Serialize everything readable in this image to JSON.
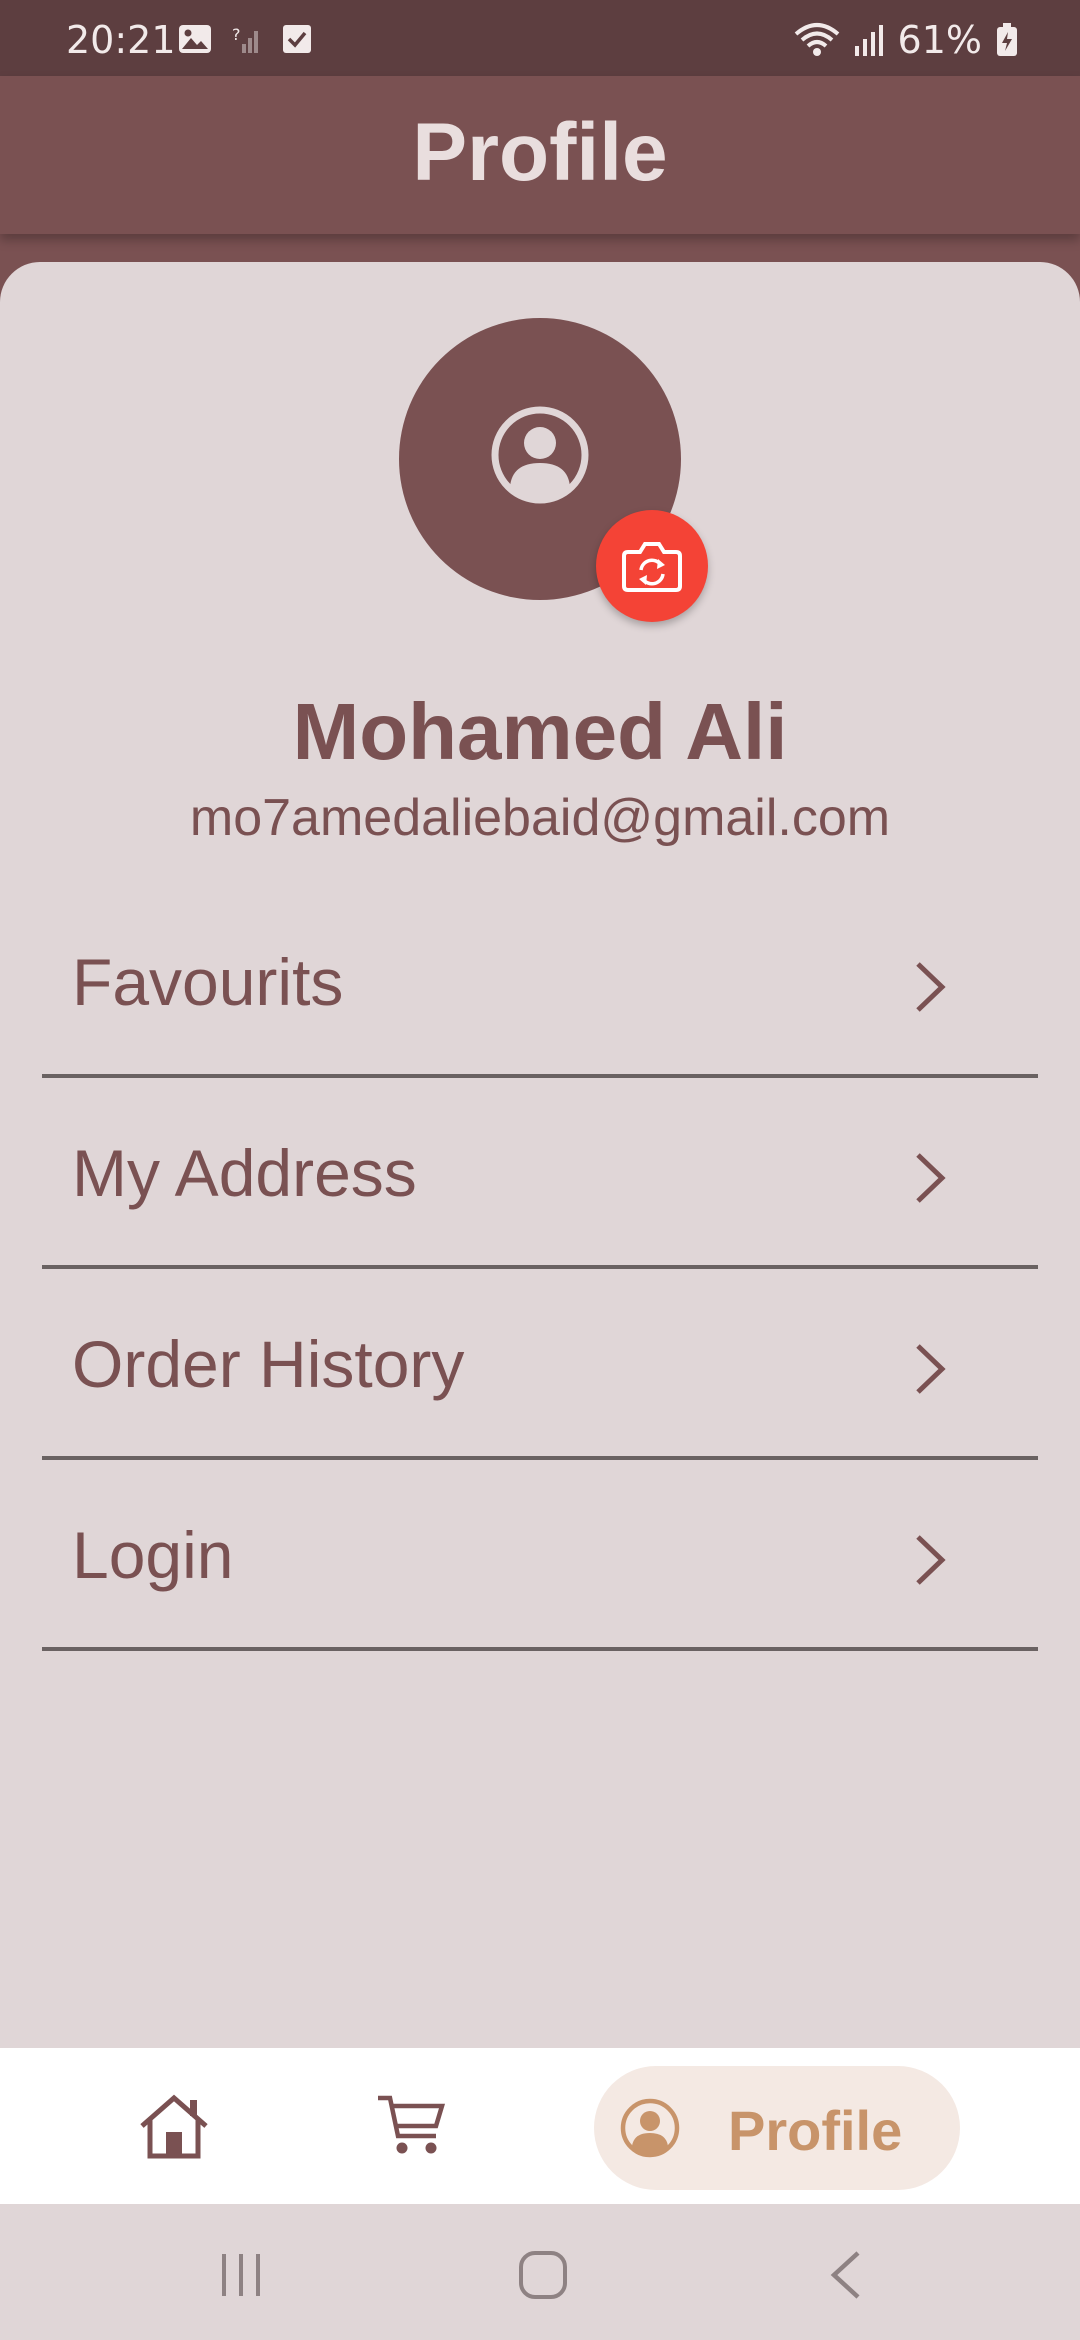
{
  "status_bar": {
    "time": "20:21",
    "battery": "61%",
    "icons": [
      "image-icon",
      "no-signal-icon",
      "checkbox-icon",
      "wifi-icon",
      "signal-icon",
      "battery-charging-icon"
    ]
  },
  "app_bar": {
    "title": "Profile"
  },
  "profile": {
    "name": "Mohamed Ali",
    "email": "mo7amedaliebaid@gmail.com",
    "avatar_icon": "person-circle-icon",
    "camera_icon": "camera-switch-icon"
  },
  "menu": {
    "items": [
      {
        "label": "Favourits",
        "icon": "chevron-right-icon"
      },
      {
        "label": "My Address",
        "icon": "chevron-right-icon"
      },
      {
        "label": "Order History",
        "icon": "chevron-right-icon"
      },
      {
        "label": "Login",
        "icon": "chevron-right-icon"
      }
    ]
  },
  "bottom_nav": {
    "items": [
      {
        "name": "home",
        "icon": "home-icon"
      },
      {
        "name": "cart",
        "icon": "cart-icon"
      }
    ],
    "active": {
      "label": "Profile",
      "icon": "person-circle-icon"
    }
  },
  "colors": {
    "primary": "#7A5152",
    "status_bar": "#5D3E40",
    "background": "#E0D6D7",
    "accent_red": "#F44336",
    "active_tab_text": "#C8946A",
    "active_tab_bg": "#F4E9E3"
  }
}
